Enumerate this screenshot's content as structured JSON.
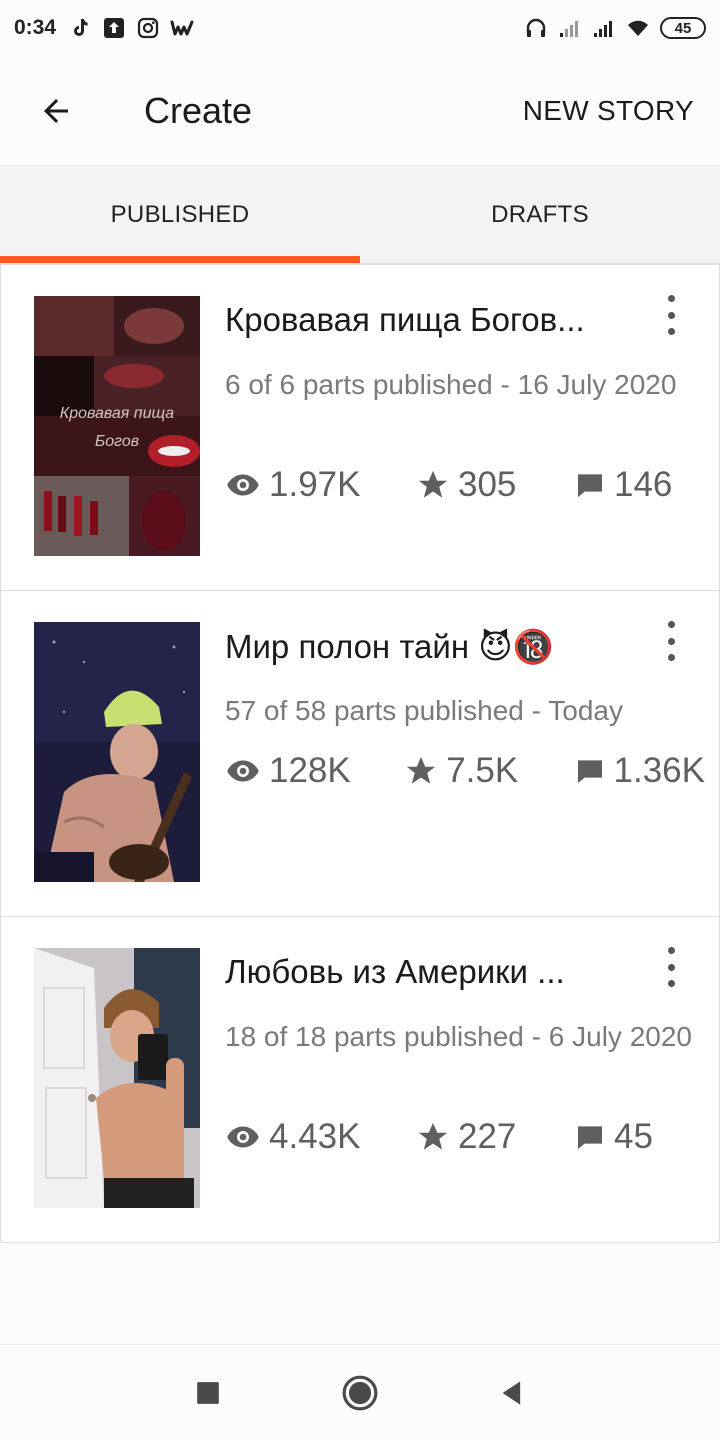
{
  "status_bar": {
    "time": "0:34",
    "left_icons": [
      "tiktok-icon",
      "upload-icon",
      "instagram-icon",
      "wattpad-icon"
    ],
    "right_icons": [
      "headphones-icon",
      "signal-1-icon",
      "signal-2-icon",
      "wifi-icon"
    ],
    "battery": "45"
  },
  "app_bar": {
    "title": "Create",
    "new_story_label": "NEW STORY"
  },
  "tabs": [
    {
      "label": "PUBLISHED",
      "active": true
    },
    {
      "label": "DRAFTS",
      "active": false
    }
  ],
  "stories": [
    {
      "title": "Кровавая пища Богов...",
      "cover_text_1": "Кровавая пища",
      "cover_text_2": "Богов",
      "meta": "6 of 6 parts published - 16 July 2020",
      "views": "1.97K",
      "votes": "305",
      "comments": "146"
    },
    {
      "title": "Мир полон тайн 😈🔞",
      "meta": "57 of 58 parts published - Today",
      "views": "128K",
      "votes": "7.5K",
      "comments": "1.36K"
    },
    {
      "title": "Любовь из Америки ...",
      "meta": "18 of 18 parts published - 6 July 2020",
      "views": "4.43K",
      "votes": "227",
      "comments": "45"
    }
  ],
  "colors": {
    "accent": "#ff5a1f",
    "meta_text": "#7a7a7a",
    "stat_text": "#5f5f5f"
  },
  "nav_icons": [
    "recent-apps-icon",
    "home-icon",
    "back-triangle-icon"
  ]
}
